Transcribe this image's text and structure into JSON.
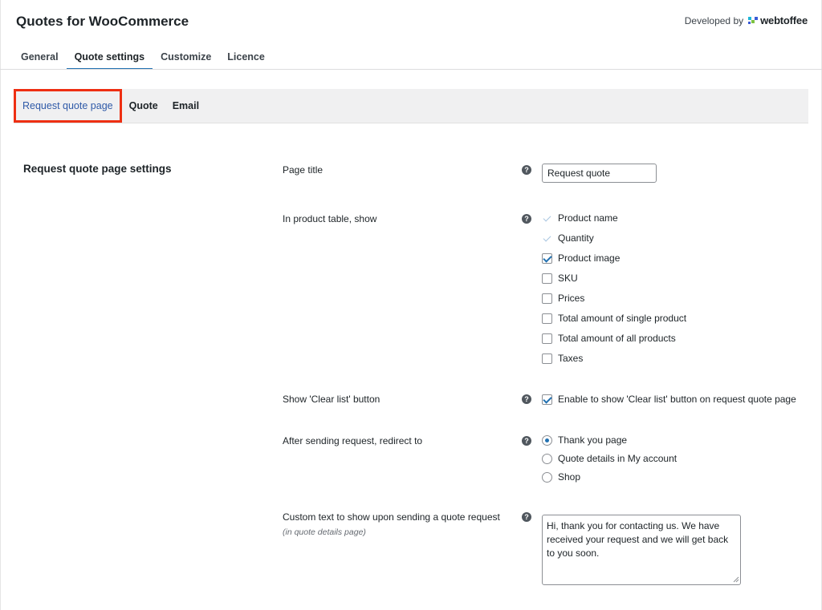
{
  "header": {
    "title": "Quotes for WooCommerce",
    "developed_by": "Developed by",
    "brand_name": "webtoffee",
    "brand_colors": [
      "#1fb6d8",
      "#7dc242",
      "#3a5bd6",
      "#1d2327"
    ]
  },
  "main_tabs": [
    {
      "label": "General"
    },
    {
      "label": "Quote settings",
      "active": true
    },
    {
      "label": "Customize"
    },
    {
      "label": "Licence"
    }
  ],
  "sub_tabs": [
    {
      "label": "Request quote page",
      "active": true
    },
    {
      "label": "Quote"
    },
    {
      "label": "Email"
    }
  ],
  "section": {
    "title": "Request quote page settings"
  },
  "fields": {
    "page_title": {
      "label": "Page title",
      "value": "Request quote"
    },
    "product_table": {
      "label": "In product table, show",
      "options": [
        {
          "label": "Product name",
          "state": "checked-disabled"
        },
        {
          "label": "Quantity",
          "state": "checked-disabled"
        },
        {
          "label": "Product image",
          "state": "checked"
        },
        {
          "label": "SKU",
          "state": "unchecked"
        },
        {
          "label": "Prices",
          "state": "unchecked"
        },
        {
          "label": "Total amount of single product",
          "state": "unchecked"
        },
        {
          "label": "Total amount of all products",
          "state": "unchecked"
        },
        {
          "label": "Taxes",
          "state": "unchecked"
        }
      ]
    },
    "clear_list": {
      "label": "Show 'Clear list' button",
      "option": "Enable to show 'Clear list' button on request quote page",
      "checked": true
    },
    "redirect": {
      "label": "After sending request, redirect to",
      "options": [
        {
          "label": "Thank you page",
          "selected": true
        },
        {
          "label": "Quote details in My account",
          "selected": false
        },
        {
          "label": "Shop",
          "selected": false
        }
      ]
    },
    "custom_text": {
      "label": "Custom text to show upon sending a quote request",
      "sublabel": "(in quote details page)",
      "value": "Hi, thank you for contacting us. We have received your request and we will get back to you soon."
    }
  },
  "help_icon_glyph": "?",
  "colors": {
    "accent": "#2271b1",
    "highlight_border": "#ee2f12"
  }
}
